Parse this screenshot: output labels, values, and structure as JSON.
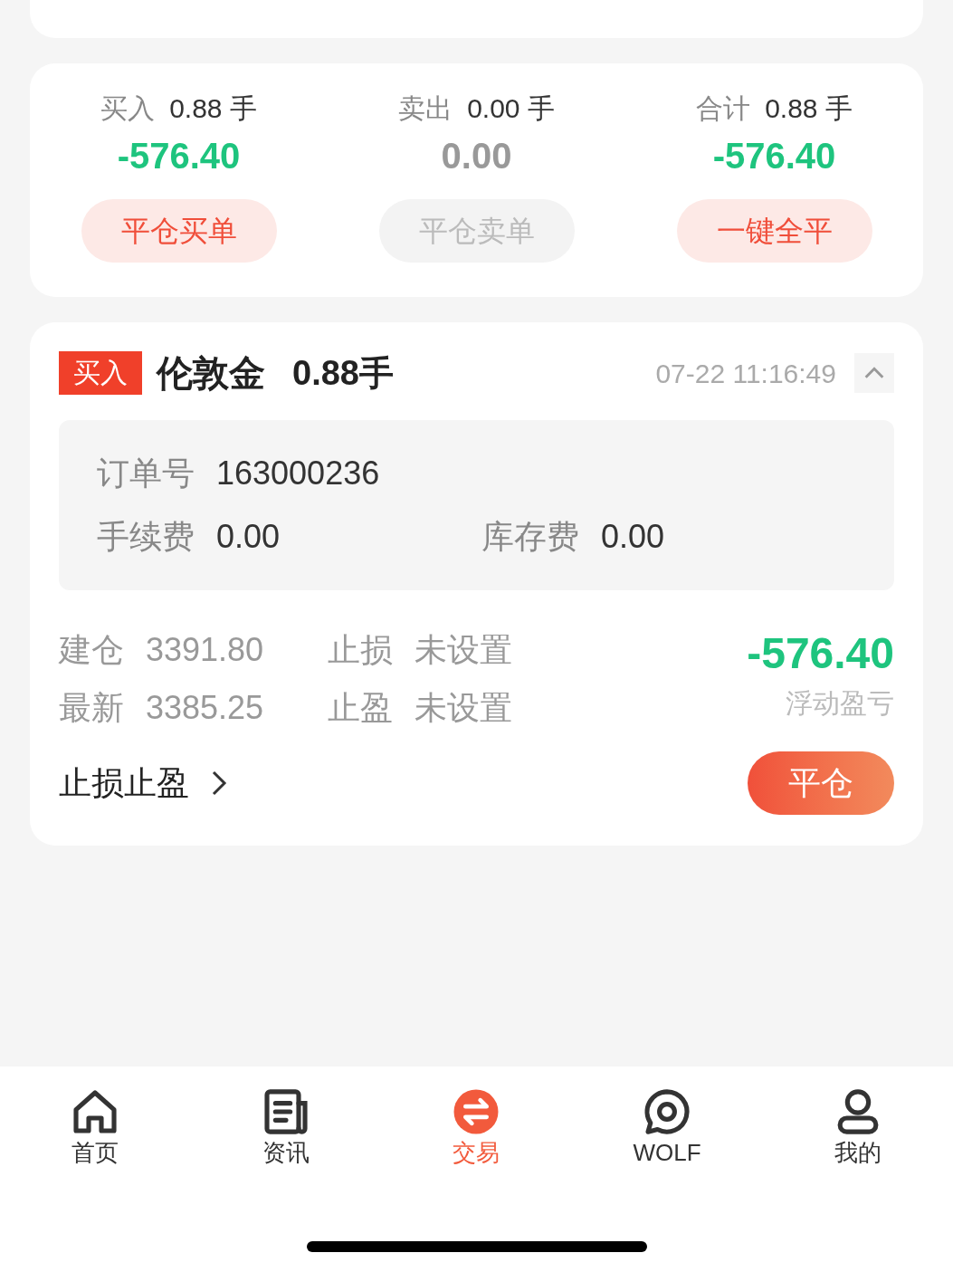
{
  "summary": [
    {
      "label": "买入",
      "lots": "0.88 手",
      "pnl": "-576.40",
      "color": "#1ec47e",
      "button": {
        "label": "平仓买单",
        "disabled": false
      }
    },
    {
      "label": "卖出",
      "lots": "0.00 手",
      "pnl": "0.00",
      "color": "#999999",
      "button": {
        "label": "平仓卖单",
        "disabled": true
      }
    },
    {
      "label": "合计",
      "lots": "0.88 手",
      "pnl": "-576.40",
      "color": "#1ec47e",
      "button": {
        "label": "一键全平",
        "disabled": false
      }
    }
  ],
  "position": {
    "side": "买入",
    "symbol": "伦敦金",
    "lots": "0.88手",
    "time": "07-22 11:16:49",
    "expanded": true,
    "details": [
      {
        "label": "订单号",
        "value": "163000236"
      },
      {
        "label": "手续费",
        "value": "0.00"
      },
      {
        "label": "库存费",
        "value": "0.00"
      }
    ],
    "stats": [
      {
        "label": "建仓",
        "value": "3391.80"
      },
      {
        "label": "止损",
        "value": "未设置"
      },
      {
        "label": "最新",
        "value": "3385.25"
      },
      {
        "label": "止盈",
        "value": "未设置"
      }
    ],
    "pnl": "-576.40",
    "pnl_label": "浮动盈亏",
    "sl_tp_link": "止损止盈",
    "close_button": "平仓"
  },
  "tab_bar": [
    {
      "label": "首页",
      "kind": "home",
      "selected": false
    },
    {
      "label": "资讯",
      "kind": "news",
      "selected": false
    },
    {
      "label": "交易",
      "kind": "trade",
      "selected": true
    },
    {
      "label": "WOLF",
      "kind": "chat",
      "selected": false
    },
    {
      "label": "我的",
      "kind": "user",
      "selected": false
    }
  ]
}
